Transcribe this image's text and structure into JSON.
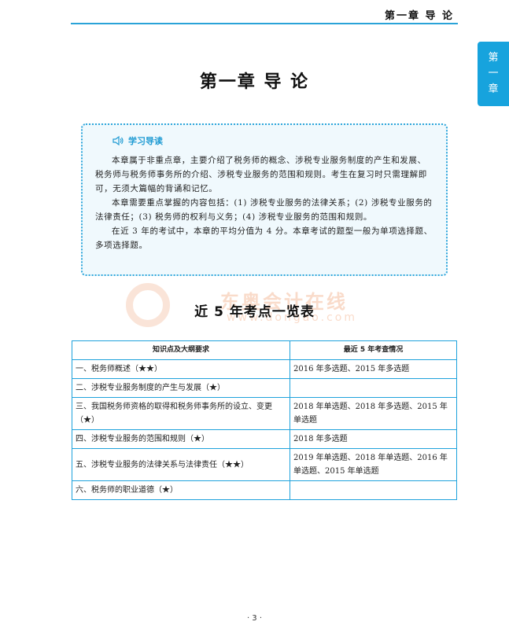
{
  "header": {
    "running_title": "第一章  导  论"
  },
  "chapter_tab": {
    "chars": [
      "第",
      "一",
      "章"
    ]
  },
  "chapter_title": "第一章  导  论",
  "study_guide": {
    "label": "学习导读",
    "paragraphs": [
      "本章属于非重点章，主要介绍了税务师的概念、涉税专业服务制度的产生和发展、税务师与税务师事务所的介绍、涉税专业服务的范围和规则。考生在复习时只需理解即可，无须大篇幅的背诵和记忆。",
      "本章需要重点掌握的内容包括：(1) 涉税专业服务的法律关系；(2) 涉税专业服务的法律责任；(3) 税务师的权利与义务；(4) 涉税专业服务的范围和规则。",
      "在近 3 年的考试中，本章的平均分值为 4 分。本章考试的题型一般为单项选择题、多项选择题。"
    ]
  },
  "watermark": {
    "name": "东奥会计在线",
    "url": "www.dongao.com"
  },
  "exam_table": {
    "title": "近 5 年考点一览表",
    "headers": [
      "知识点及大纲要求",
      "最近 5 年考查情况"
    ],
    "rows": [
      {
        "topic": "一、税务师概述（★★）",
        "history": "2016 年多选题、2015 年多选题"
      },
      {
        "topic": "二、涉税专业服务制度的产生与发展（★）",
        "history": ""
      },
      {
        "topic": "三、我国税务师资格的取得和税务师事务所的设立、变更（★）",
        "history": "2018 年单选题、2018 年多选题、2015 年单选题"
      },
      {
        "topic": "四、涉税专业服务的范围和规则（★）",
        "history": "2018 年多选题"
      },
      {
        "topic": "五、涉税专业服务的法律关系与法律责任（★★）",
        "history": "2019 年单选题、2018 年单选题、2016 年单选题、2015 年单选题"
      },
      {
        "topic": "六、税务师的职业道德（★）",
        "history": ""
      }
    ]
  },
  "footer": {
    "page_number": "· 3 ·"
  }
}
